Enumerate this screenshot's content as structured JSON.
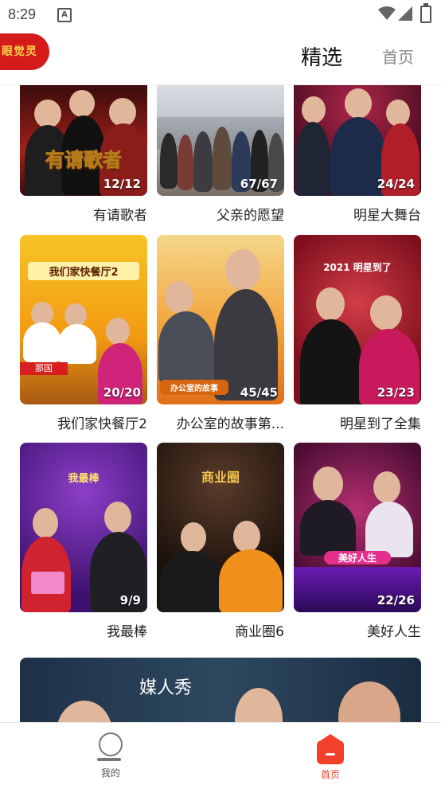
{
  "status_bar": {
    "time": "8:29",
    "notification_icon": "A"
  },
  "header": {
    "logo_text": "眼觉灵",
    "tab_active": "精选",
    "tab_home": "首页"
  },
  "grid": [
    {
      "title": "有请歌者",
      "count": "12/12",
      "art": "有请歌者"
    },
    {
      "title": "父亲的愿望",
      "count": "67/67",
      "art": ""
    },
    {
      "title": "明星大舞台",
      "count": "24/24",
      "art": ""
    },
    {
      "title": "我们家快餐厅2",
      "count": "20/20",
      "art": "我们家快餐厅2"
    },
    {
      "title": "办公室的故事第...",
      "count": "45/45",
      "art": "办公室的故事"
    },
    {
      "title": "明星到了全集",
      "count": "23/23",
      "art": "2021 明星到了"
    },
    {
      "title": "我最棒",
      "count": "9/9",
      "art": "我最棒"
    },
    {
      "title": "商业圈6",
      "count": "",
      "art": "商业圈"
    },
    {
      "title": "美好人生",
      "count": "22/26",
      "art": "美好人生"
    }
  ],
  "banner": {
    "text": "媒人秀"
  },
  "bottom_nav": {
    "me": "我的",
    "home": "首页"
  },
  "colors": {
    "accent": "#f2402a",
    "logo_bg": "#d51a1a"
  }
}
